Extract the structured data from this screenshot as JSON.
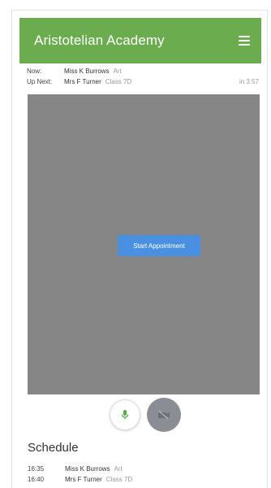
{
  "app": {
    "title": "Aristotelian Academy",
    "menu_icon": "hamburger-menu-icon"
  },
  "status": {
    "now": {
      "label": "Now:",
      "name": "Miss K Burrows",
      "detail": "Art"
    },
    "up_next": {
      "label": "Up Next:",
      "name": "Mrs F Turner",
      "detail": "Class 7D",
      "countdown": "in 3:57"
    }
  },
  "video": {
    "start_button": "Start Appointment"
  },
  "controls": {
    "mic_icon": "microphone-icon",
    "camera_icon": "camera-off-icon",
    "mic_color": "#5aa845",
    "camera_bg": "#8a8d93"
  },
  "schedule": {
    "title": "Schedule",
    "items": [
      {
        "time": "16:35",
        "name": "Miss K Burrows",
        "detail": "Art"
      },
      {
        "time": "16:40",
        "name": "Mrs F Turner",
        "detail": "Class 7D"
      }
    ]
  },
  "colors": {
    "header": "#6aac4e",
    "button": "#4a90e2",
    "video_bg": "#868686"
  }
}
